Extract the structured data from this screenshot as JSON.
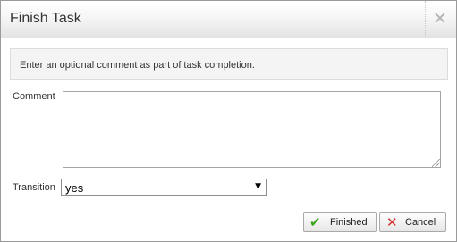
{
  "dialog": {
    "title": "Finish Task",
    "close_icon": "close-icon",
    "info_text": "Enter an optional comment as part of task completion."
  },
  "form": {
    "comment_label": "Comment",
    "comment_value": "",
    "transition_label": "Transition",
    "transition_selected": "yes",
    "transition_arrow": "▼"
  },
  "buttons": {
    "finished_label": "Finished",
    "finished_icon": "check-icon",
    "cancel_label": "Cancel",
    "cancel_icon": "x-icon"
  }
}
